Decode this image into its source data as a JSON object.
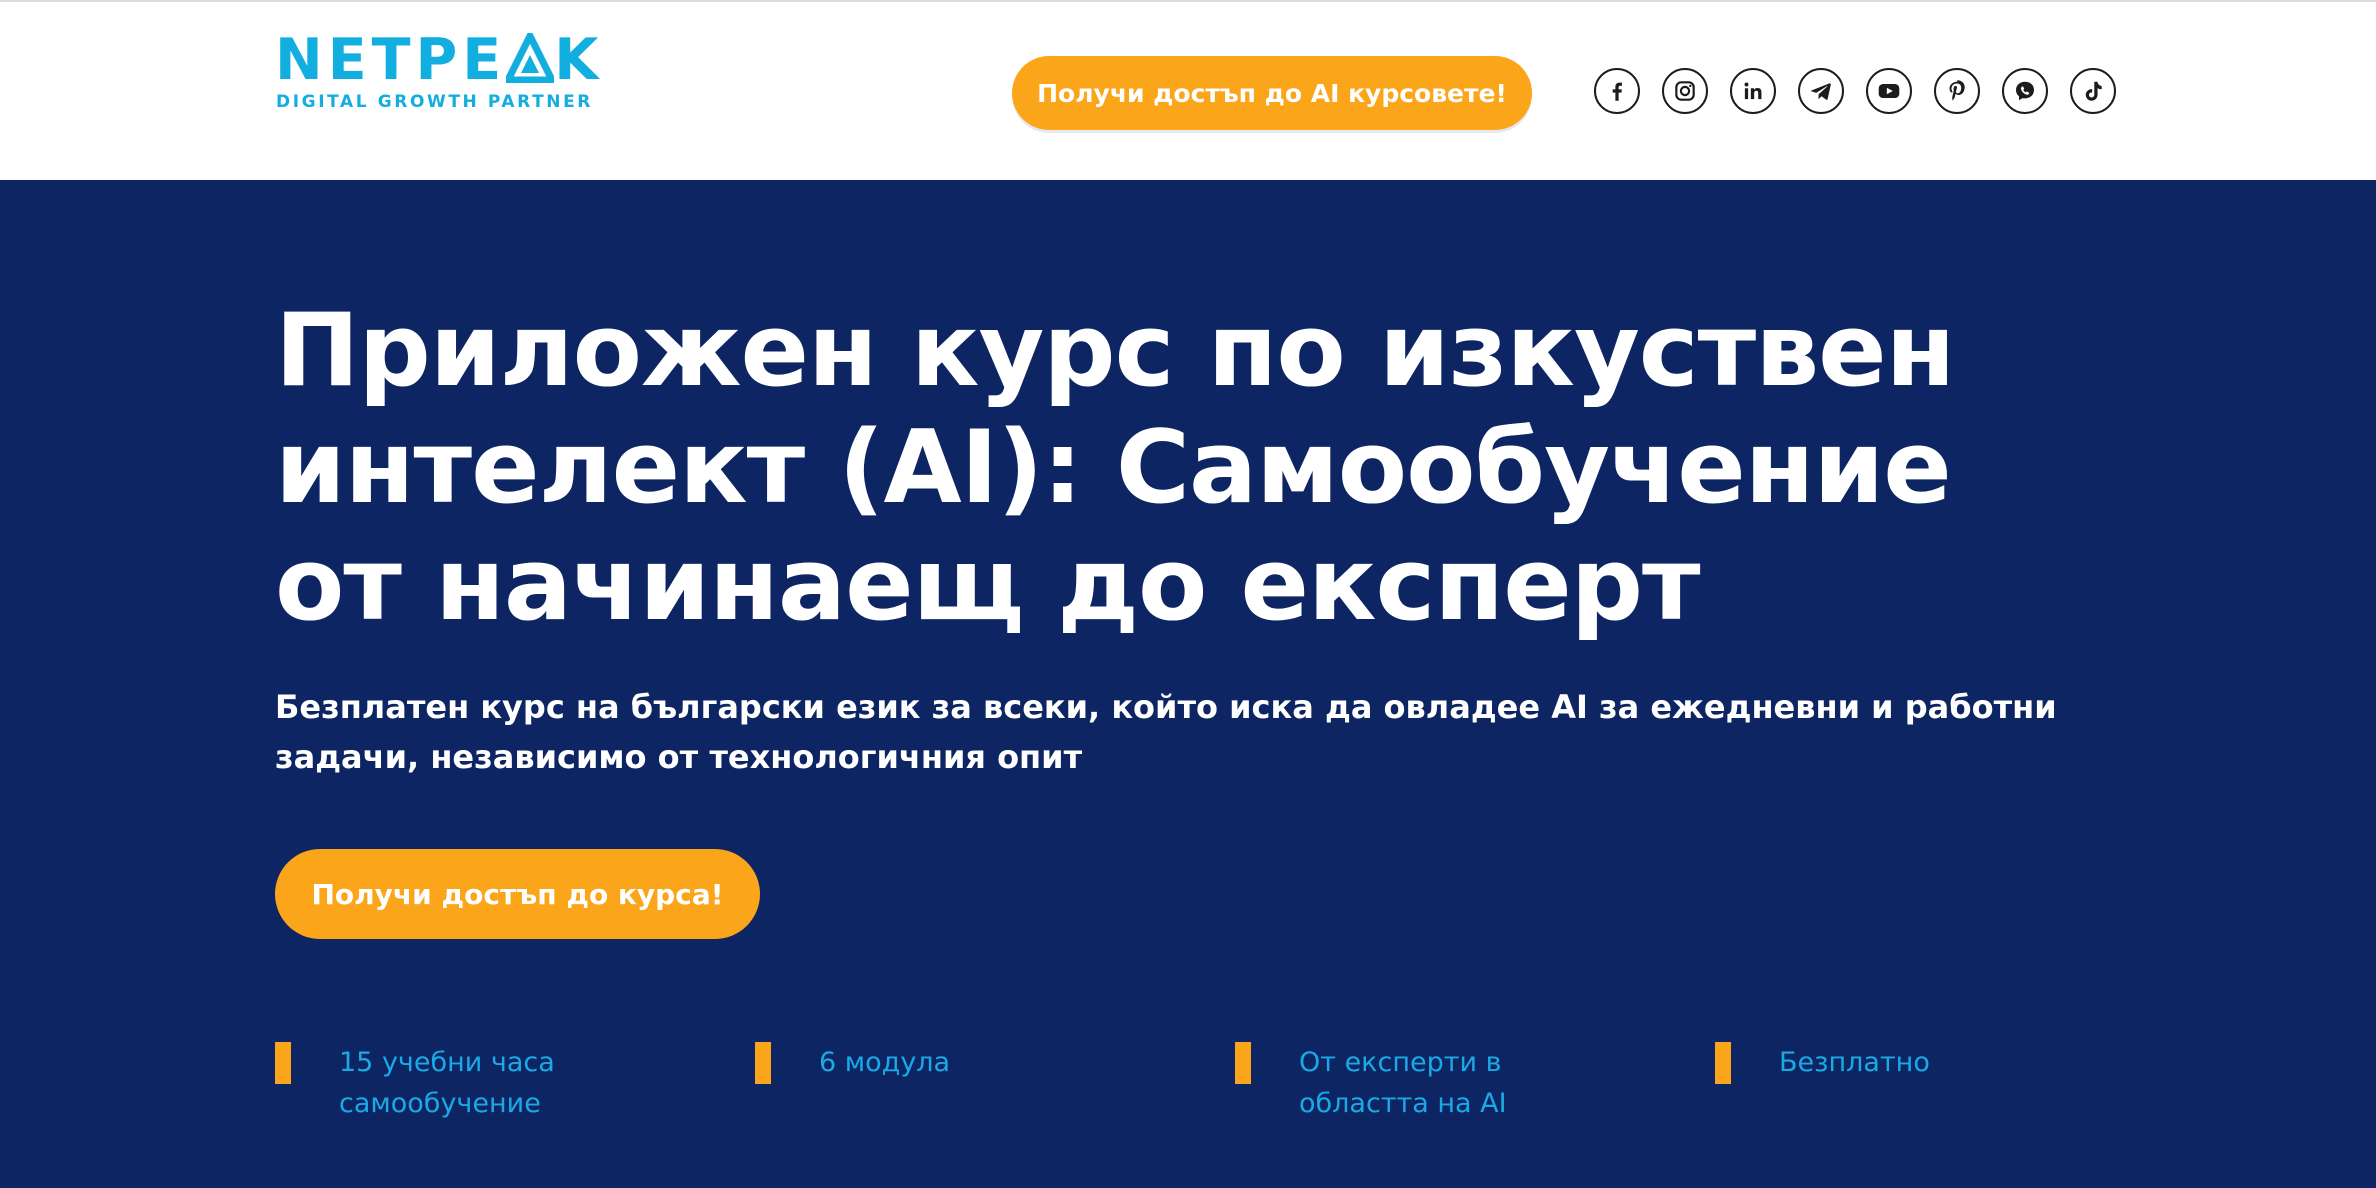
{
  "header": {
    "logo": {
      "word_prefix": "NETPE",
      "word_suffix": "K",
      "tagline": "DIGITAL GROWTH PARTNER"
    },
    "cta_label": "Получи достъп до AI курсовете!",
    "socials": [
      {
        "icon": "facebook-icon"
      },
      {
        "icon": "instagram-icon"
      },
      {
        "icon": "linkedin-icon"
      },
      {
        "icon": "telegram-icon"
      },
      {
        "icon": "youtube-icon"
      },
      {
        "icon": "pinterest-icon"
      },
      {
        "icon": "viber-icon"
      },
      {
        "icon": "tiktok-icon"
      }
    ]
  },
  "hero": {
    "title_lines": [
      "Приложен курс по изкуствен",
      "интелект (AI): Самообучение",
      "от начинаещ до експерт"
    ],
    "subtitle_lines": [
      "Безплатен курс на български език за всеки, който иска да овладее AI за ежедневни и работни",
      "задачи, независимо от технологичния опит"
    ],
    "cta_label": "Получи достъп до курса!"
  },
  "features": [
    {
      "lines": [
        "15 учебни часа",
        "самообучение"
      ]
    },
    {
      "lines": [
        "6 модула"
      ]
    },
    {
      "lines": [
        "От експерти в",
        "областта на AI"
      ]
    },
    {
      "lines": [
        "Безплатно"
      ]
    }
  ],
  "colors": {
    "brand_blue": "#13aee0",
    "hero_bg": "#0e2563",
    "accent_orange": "#fba51a",
    "feature_text": "#1aa9e4"
  }
}
